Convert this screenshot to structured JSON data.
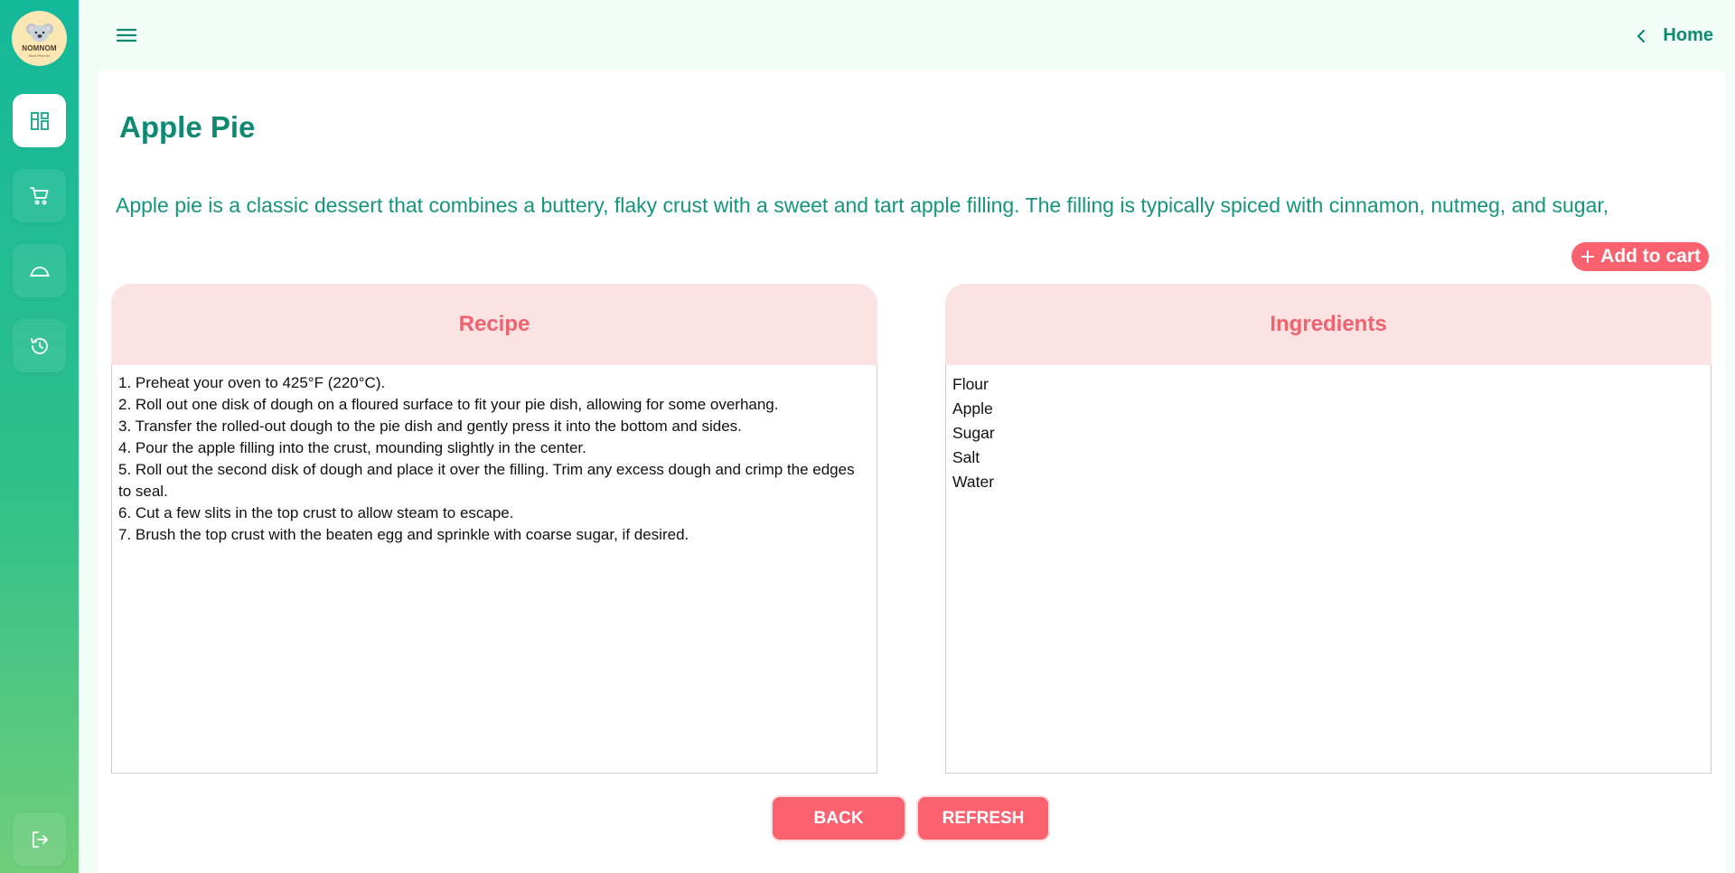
{
  "app": {
    "logo_text": "NOMNOM",
    "logo_subtext": "Meal Planner"
  },
  "sidebar": {
    "items": [
      {
        "name": "dashboard",
        "icon": "dashboard-icon",
        "active": true
      },
      {
        "name": "cart",
        "icon": "cart-icon",
        "active": false
      },
      {
        "name": "meals",
        "icon": "cloche-icon",
        "active": false
      },
      {
        "name": "history",
        "icon": "history-icon",
        "active": false
      }
    ],
    "logout_icon": "logout-icon"
  },
  "header": {
    "menu_icon": "hamburger-menu-icon",
    "home_label": "Home"
  },
  "recipe": {
    "title": "Apple Pie",
    "description": "Apple pie is a classic dessert that combines a buttery, flaky crust with a sweet and tart apple filling. The filling is typically spiced with cinnamon, nutmeg, and sugar,",
    "add_to_cart_label": "Add to cart",
    "recipe_heading": "Recipe",
    "steps": [
      "1. Preheat your oven to 425°F (220°C).",
      "2. Roll out one disk of dough on a floured surface to fit your pie dish, allowing for some overhang.",
      "3. Transfer the rolled-out dough to the pie dish and gently press it into the bottom and sides.",
      "4. Pour the apple filling into the crust, mounding slightly in the center.",
      "5. Roll out the second disk of dough and place it over the filling. Trim any excess dough and crimp the edges to seal.",
      "6. Cut a few slits in the top crust to allow steam to escape.",
      "7. Brush the top crust with the beaten egg and sprinkle with coarse sugar, if desired."
    ],
    "ingredients_heading": "Ingredients",
    "ingredients": [
      "Flour",
      "Apple",
      "Sugar",
      "Salt",
      "Water"
    ]
  },
  "actions": {
    "back_label": "BACK",
    "refresh_label": "REFRESH"
  },
  "colors": {
    "primary_green": "#0e8a73",
    "accent_pink": "#f9626e",
    "panel_head_bg": "#fbe3e4"
  }
}
